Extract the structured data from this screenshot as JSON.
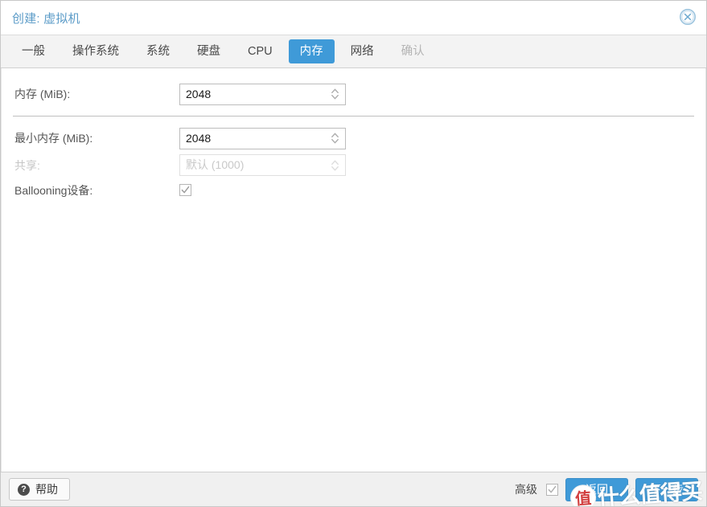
{
  "window": {
    "title": "创建: 虚拟机",
    "close_icon": "close-circle-icon"
  },
  "tabs": [
    {
      "label": "一般",
      "state": "normal"
    },
    {
      "label": "操作系统",
      "state": "normal"
    },
    {
      "label": "系统",
      "state": "normal"
    },
    {
      "label": "硬盘",
      "state": "normal"
    },
    {
      "label": "CPU",
      "state": "normal"
    },
    {
      "label": "内存",
      "state": "active"
    },
    {
      "label": "网络",
      "state": "normal"
    },
    {
      "label": "确认",
      "state": "disabled"
    }
  ],
  "form": {
    "memory": {
      "label": "内存 (MiB):",
      "value": "2048",
      "placeholder": "",
      "disabled": false
    },
    "min_memory": {
      "label": "最小内存 (MiB):",
      "value": "2048",
      "placeholder": "",
      "disabled": false
    },
    "shares": {
      "label": "共享:",
      "value": "",
      "placeholder": "默认 (1000)",
      "disabled": true
    },
    "ballooning": {
      "label": "Ballooning设备:",
      "checked": true
    }
  },
  "footer": {
    "help_label": "帮助",
    "help_icon": "question-mark-icon",
    "advanced_label": "高级",
    "advanced_checked": true,
    "back_label": "返回",
    "next_label": "下一步"
  },
  "watermark": {
    "badge": "值",
    "text": "什么值得买"
  },
  "colors": {
    "accent": "#3f9ad8",
    "title": "#5c9cc8",
    "tabbar_bg": "#f3f3f3",
    "footer_bg": "#f0f0f0",
    "disabled_text": "#c6c6c6"
  }
}
